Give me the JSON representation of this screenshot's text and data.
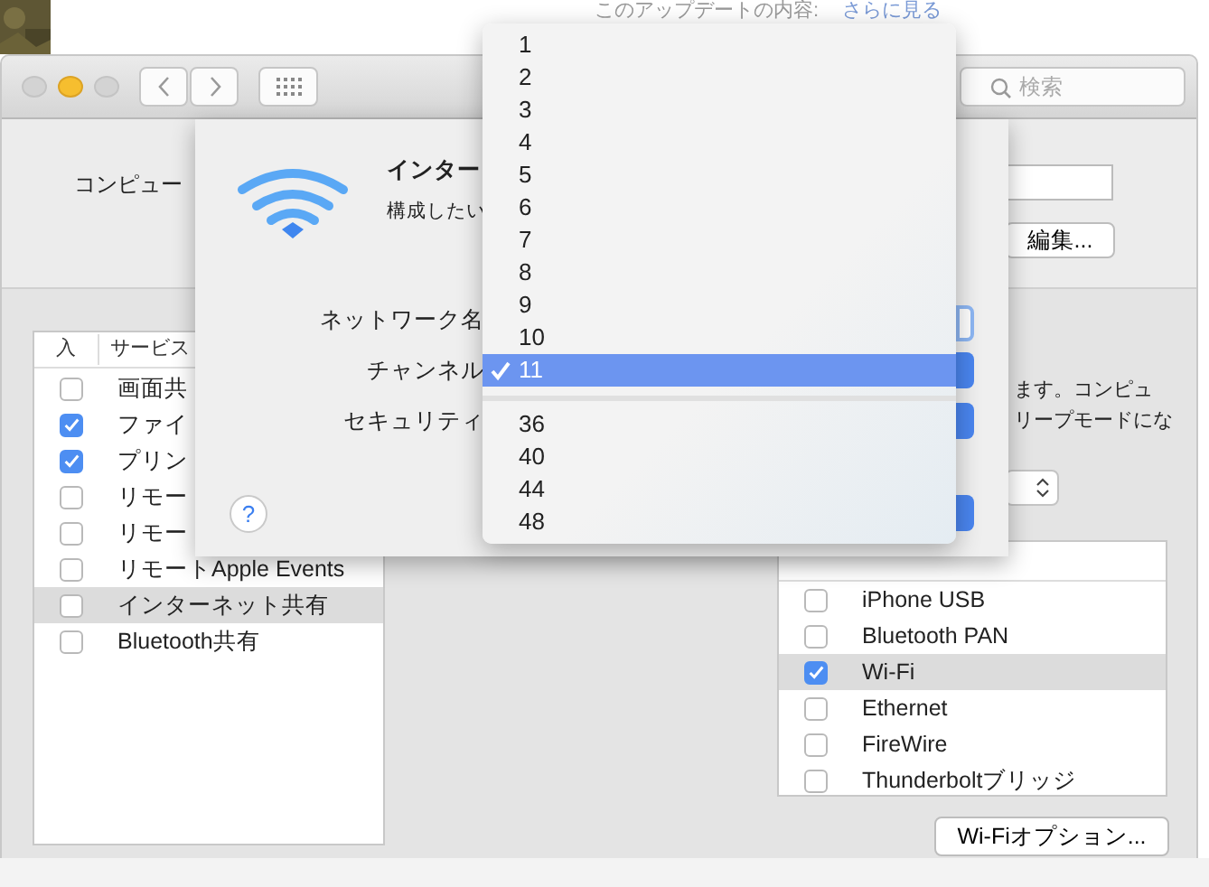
{
  "background": {
    "update_text": "このアップデートの内容:",
    "more_link": "さらに見る"
  },
  "window": {
    "search": {
      "placeholder": "検索"
    },
    "computer_label": "コンピュー",
    "edit_button": "編集...",
    "services": {
      "columns": [
        "入",
        "サービス"
      ],
      "rows": [
        {
          "label": "画面共",
          "checked": false,
          "selected": false
        },
        {
          "label": "ファイ",
          "checked": true,
          "selected": false
        },
        {
          "label": "プリン",
          "checked": true,
          "selected": false
        },
        {
          "label": "リモー",
          "checked": false,
          "selected": false
        },
        {
          "label": "リモー",
          "checked": false,
          "selected": false
        },
        {
          "label": "リモートApple Events",
          "checked": false,
          "selected": false
        },
        {
          "label": "インターネット共有",
          "checked": false,
          "selected": true
        },
        {
          "label": "Bluetooth共有",
          "checked": false,
          "selected": false
        }
      ]
    },
    "description": [
      "ます。コンピュ",
      "リープモードにな"
    ],
    "ports": {
      "rows": [
        {
          "label": "iPhone USB",
          "checked": false,
          "selected": false
        },
        {
          "label": "Bluetooth PAN",
          "checked": false,
          "selected": false
        },
        {
          "label": "Wi-Fi",
          "checked": true,
          "selected": true
        },
        {
          "label": "Ethernet",
          "checked": false,
          "selected": false
        },
        {
          "label": "FireWire",
          "checked": false,
          "selected": false
        },
        {
          "label": "Thunderboltブリッジ",
          "checked": false,
          "selected": false
        }
      ]
    },
    "wifi_options_button": "Wi-Fiオプション..."
  },
  "sheet": {
    "title": "インター",
    "subtitle": "構成したい",
    "fields": [
      "ネットワーク名",
      "チャンネル",
      "セキュリティ"
    ],
    "help": "?"
  },
  "channel_menu": {
    "items": [
      {
        "kind": "item",
        "label": "1",
        "selected": false
      },
      {
        "kind": "item",
        "label": "2",
        "selected": false
      },
      {
        "kind": "item",
        "label": "3",
        "selected": false
      },
      {
        "kind": "item",
        "label": "4",
        "selected": false
      },
      {
        "kind": "item",
        "label": "5",
        "selected": false
      },
      {
        "kind": "item",
        "label": "6",
        "selected": false
      },
      {
        "kind": "item",
        "label": "7",
        "selected": false
      },
      {
        "kind": "item",
        "label": "8",
        "selected": false
      },
      {
        "kind": "item",
        "label": "9",
        "selected": false
      },
      {
        "kind": "item",
        "label": "10",
        "selected": false
      },
      {
        "kind": "item",
        "label": "11",
        "selected": true
      },
      {
        "kind": "separator"
      },
      {
        "kind": "item",
        "label": "36",
        "selected": false
      },
      {
        "kind": "item",
        "label": "40",
        "selected": false
      },
      {
        "kind": "item",
        "label": "44",
        "selected": false
      },
      {
        "kind": "item",
        "label": "48",
        "selected": false
      }
    ]
  }
}
